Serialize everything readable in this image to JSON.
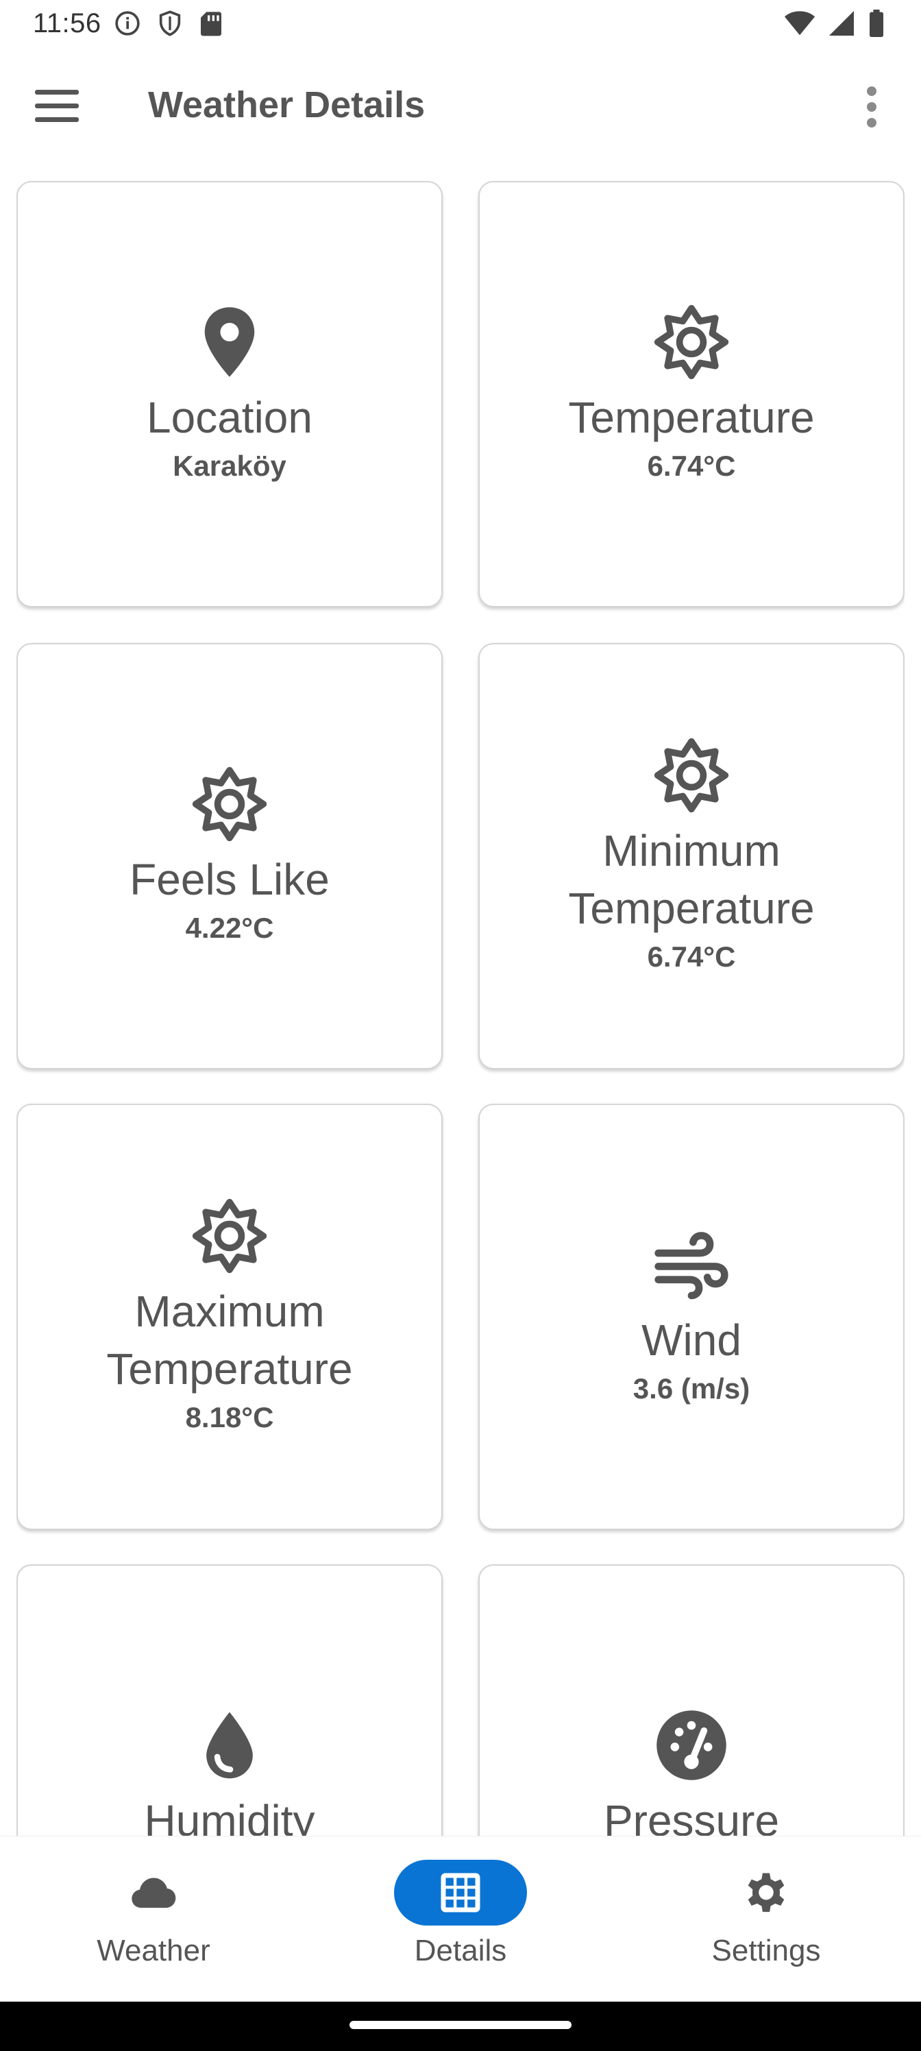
{
  "status_bar": {
    "time": "11:56"
  },
  "app_bar": {
    "title": "Weather Details"
  },
  "cards": [
    {
      "title": "Location",
      "value": "Karaköy",
      "icon": "location-pin-icon"
    },
    {
      "title": "Temperature",
      "value": "6.74°C",
      "icon": "sun-icon"
    },
    {
      "title": "Feels Like",
      "value": "4.22°C",
      "icon": "sun-icon"
    },
    {
      "title": "Minimum Temperature",
      "value": "6.74°C",
      "icon": "sun-icon"
    },
    {
      "title": "Maximum Temperature",
      "value": "8.18°C",
      "icon": "sun-icon"
    },
    {
      "title": "Wind",
      "value": "3.6 (m/s)",
      "icon": "wind-icon"
    },
    {
      "title": "Humidity",
      "value": "",
      "icon": "water-drop-icon"
    },
    {
      "title": "Pressure",
      "value": "",
      "icon": "gauge-icon"
    }
  ],
  "bottom_nav": {
    "items": [
      {
        "label": "Weather",
        "icon": "cloud-icon",
        "active": false
      },
      {
        "label": "Details",
        "icon": "grid-icon",
        "active": true
      },
      {
        "label": "Settings",
        "icon": "gear-icon",
        "active": false
      }
    ]
  },
  "colors": {
    "accent": "#0a74d4",
    "icon": "#555555",
    "text": "#555555",
    "card_border": "#d4d4d4"
  }
}
